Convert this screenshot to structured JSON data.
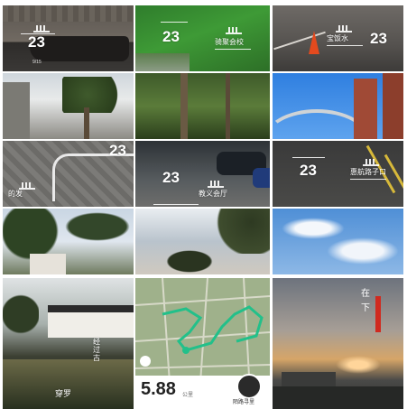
{
  "tiles": {
    "t1": {
      "number": "23",
      "date": "9/15"
    },
    "t2": {
      "number": "23",
      "place": "骑聚会校"
    },
    "t3": {
      "number": "23",
      "place": "宝饭水"
    },
    "t7": {
      "number": "23",
      "place": "的发"
    },
    "t8": {
      "number": "23",
      "place": "教义会厅"
    },
    "t9": {
      "number": "23",
      "place": "惠航路子口"
    },
    "t13": {
      "caption_vertical": "经过古",
      "caption_bottom": "穿罗"
    },
    "t14": {
      "distance": "5.88",
      "unit": "公里",
      "user": "陌路寻里"
    },
    "t15": {
      "vertical_text": "在 下"
    }
  }
}
